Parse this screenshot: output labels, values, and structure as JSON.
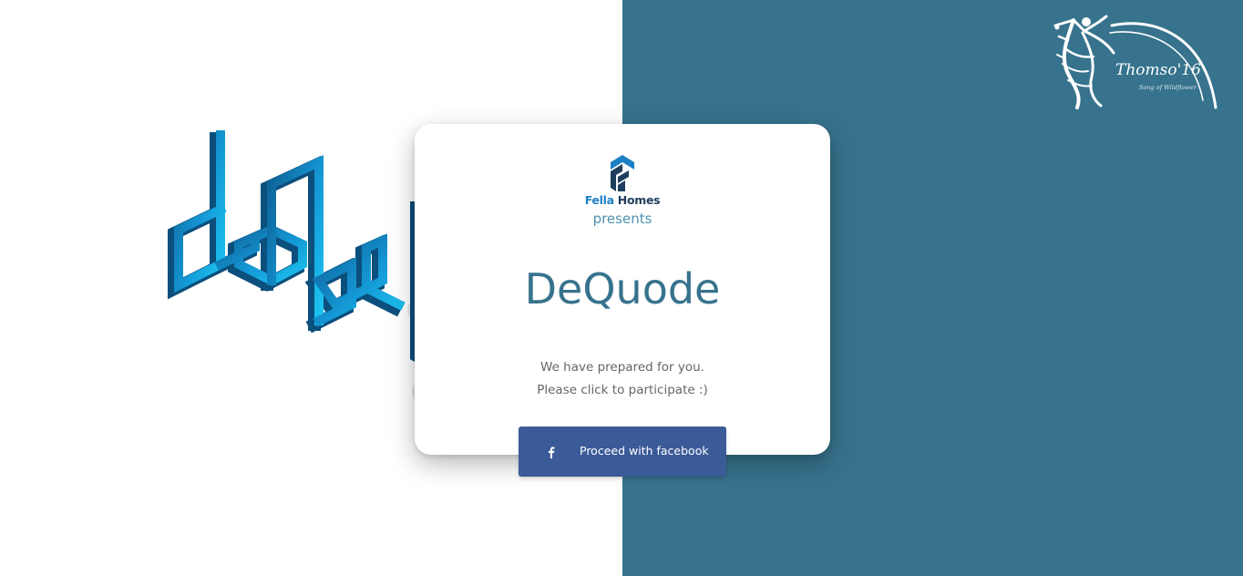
{
  "colors": {
    "right_panel": "#37738d",
    "title": "#37738d",
    "presents": "#4f92b0",
    "facebook_button": "#3b5a98",
    "fella_brand_blue": "#1d7fc4",
    "fella_brand_navy": "#1f3d5c"
  },
  "icons": {
    "dequode_logo": "dequode-3d-logo",
    "thomso_logo": "thomso-16-logo",
    "fella_logo": "fella-homes-logo",
    "facebook": "facebook-icon"
  },
  "header": {
    "thomso_logo_text": "Thomso'16",
    "thomso_tagline": "Song of Wildflower"
  },
  "card": {
    "sponsor_name_part1": "Fella",
    "sponsor_name_part2": "Homes",
    "presents": "presents",
    "title": "DeQuode",
    "line1": "We have prepared for you.",
    "line2": "Please click to participate :)"
  },
  "actions": {
    "facebook_label": "Proceed with facebook"
  }
}
